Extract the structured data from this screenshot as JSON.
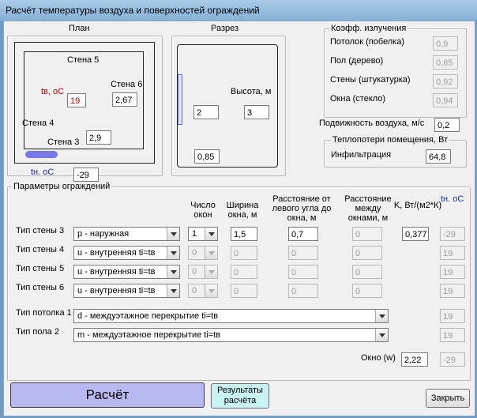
{
  "window": {
    "title": "Расчёт температуры воздуха и поверхностей ограждений"
  },
  "plan": {
    "heading": "План",
    "wall5": "Стена 5",
    "wall6": "Стена 6",
    "wall4": "Стена 4",
    "wall3": "Стена 3",
    "tv_label": "tв, оС",
    "tv_value": "19",
    "wall6_value": "2,67",
    "wall3_value": "2,9",
    "tn_label": "tн. оС",
    "tn_value": "-29"
  },
  "section": {
    "heading": "Разрез",
    "height_label": "Высота, м",
    "height_value": "3",
    "window_value": "2",
    "sill_value": "0,85"
  },
  "emission": {
    "legend": "Коэфф. излучения",
    "items": [
      {
        "label": "Потолок (побелка)",
        "value": "0,9"
      },
      {
        "label": "Пол (дерево)",
        "value": "0,85"
      },
      {
        "label": "Стены (штукатурка)",
        "value": "0,92"
      },
      {
        "label": "Окна (стекло)",
        "value": "0,94"
      }
    ]
  },
  "air": {
    "label": "Подвижность воздуха, м/с",
    "value": "0,2"
  },
  "heatloss": {
    "legend": "Теплопотери помещения, Вт",
    "label": "Инфильтрация",
    "value": "64,8"
  },
  "params": {
    "legend": "Параметры ограждений",
    "headers": {
      "count": "Число окон",
      "width": "Ширина окна, м",
      "dist_left": "Расстояние от левого угла до окна, м",
      "dist_between": "Расстояние между окнами, м",
      "k": "K, Вт/(м2*К)",
      "tn": "tн. оС"
    },
    "walls": [
      {
        "label": "Тип стены 3",
        "type": "р - наружная",
        "count": "1",
        "width": "1,5",
        "dist_left": "0,7",
        "dist_between": "0",
        "k": "0,377",
        "t": "-29"
      },
      {
        "label": "Тип стены 4",
        "type": "u - внутренняя ti=tв",
        "count": "0",
        "width": "0",
        "dist_left": "0",
        "dist_between": "0",
        "k": "",
        "t": "19"
      },
      {
        "label": "Тип стены 5",
        "type": "u - внутренняя ti=tв",
        "count": "0",
        "width": "0",
        "dist_left": "0",
        "dist_between": "0",
        "k": "",
        "t": "19"
      },
      {
        "label": "Тип стены 6",
        "type": "u - внутренняя ti=tв",
        "count": "0",
        "width": "0",
        "dist_left": "0",
        "dist_between": "0",
        "k": "",
        "t": "19"
      }
    ],
    "ceiling": {
      "label": "Тип потолка 1",
      "type": "d - междуэтажное перекрытие ti=tв",
      "t": "19"
    },
    "floor": {
      "label": "Тип пола 2",
      "type": "m - междуэтажное перекрытие ti=tв",
      "t": "19"
    },
    "window": {
      "label": "Окно (w)",
      "k": "2,22",
      "t": "-29"
    }
  },
  "buttons": {
    "calculate": "Расчёт",
    "results": "Результаты расчёта",
    "close": "Закрыть"
  },
  "colors": {
    "accent_red": "#c00000",
    "accent_blue": "#1f2e9e",
    "calc_button": "#b9b9f2",
    "results_button": "#c9f2f2"
  }
}
